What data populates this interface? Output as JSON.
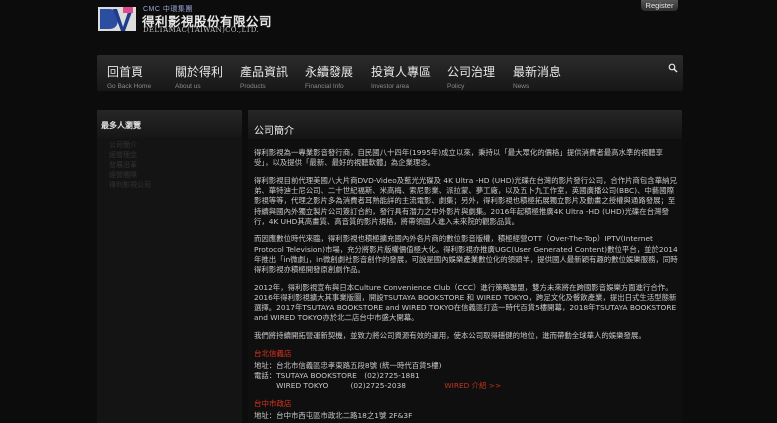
{
  "header": {
    "cmc": "CMC 中環集團",
    "company_cn": "得利影視股份有限公司",
    "company_en": "DELTAMAC(TAIWAN)CO.,LTD.",
    "register_label": "Register"
  },
  "nav": [
    {
      "zh": "回首頁",
      "en": "Go Back Home"
    },
    {
      "zh": "關於得利",
      "en": "About us"
    },
    {
      "zh": "產品資訊",
      "en": "Products"
    },
    {
      "zh": "永續發展",
      "en": "Financial Info"
    },
    {
      "zh": "投資人專區",
      "en": "Investor area"
    },
    {
      "zh": "公司治理",
      "en": "Policy"
    },
    {
      "zh": "最新消息",
      "en": "News"
    }
  ],
  "sidebar": {
    "title": "最多人瀏覽",
    "links": [
      "公司簡介",
      "經營理念",
      "發展沿革",
      "經營團隊",
      "得利影視公司"
    ]
  },
  "main": {
    "title": "公司簡介",
    "paragraphs": [
      "得利影視為一專業影音發行商，自民國八十四年(1995年)成立以來，秉持以「最大眾化的價格」提供消費者最高水準的視聽享受」，以及提供「最新、最好的視聽軟體」為企業理念。",
      "得利影視目前代理美國八大片商DVD-Video及藍光光碟及 4K Ultra -HD (UHD)光碟在台灣的影片發行公司，合作片商包含華納兄弟、華特迪士尼公司、二十世紀福斯、米高梅、索尼影業、派拉蒙、夢工廠，以及五卜九工作室，英國廣播公司(BBC)、中藝國際影視等等，代理之影片多為消費者耳熟能詳的主流電影、劇集；另外，得利影視也積極拓展獨立影片及動畫之授權與通路發展；至持續與國內外獨立製片公司簽訂合約，發行具有潛力之中外影片與劇集。2016年起積極推廣4K Ultra -HD (UHD)光碟在台灣發行，4K UHD其高畫質、高音質的影片規格，將帶領國人進入未來院的觀影品質。",
      "而因應數位時代來臨，得利影視也積極擴充國內外各片商的數位影音版權，積極經營OTT（Over-The-Top）IPTV(Internet Protocol Television)市場，充分將影片版權價值極大化。得利影視亦推廣UGC(User Generated Content)數位平台，並於2014年推出「in微劇」，in微創劇社影音創作的發展，可說是國內娛樂產業數位化的領頭羊，提供國人最新穎有趣的數位娛樂服務，同時得利影視亦積極開發原創劇作品。",
      "2012年，得利影視宣布與日本Culture Convenience Club（CCC）進行策略聯盟，雙方未來將在跨國影音娛樂方面進行合作。2016年得利影視擴大其事業版圖，開設TSUTAYA BOOKSTORE 和 WIRED TOKYO，跨足文化及餐飲產業，提出日式生活型態新選擇。2017年TSUTAYA BOOKSTORE and WIRED TOKYO在信義區打造一時代百貨5樓開幕，2018年TSUTAYA BOOKSTORE and WIRED TOKYO亦於北二店台中市盛大開幕。",
      "我們將持續開拓營運新契機，並致力將公司資源有效的運用，使本公司取得穩健的地位，進而帶動全球華人的娛樂發展。"
    ],
    "branch1": {
      "name": "台北信義店",
      "address": "地址：台北市信義區忠孝東路五段8號 (統一時代百貨5樓)",
      "phone1": "電話：TSUTAYA BOOKSTORE　(02)2725-1881",
      "phone2": "　　　WIRED TOKYO　　　(02)2725-2038",
      "wired_link": "WIRED 介紹 >>"
    },
    "branch2": {
      "name": "台中市政店",
      "address": "地址：台中市西屯區市政北二路18之1號 2F&3F"
    }
  },
  "colors": {
    "accent": "#e0331f",
    "background": "#0c0c0c"
  },
  "icons": {
    "search": "search-icon"
  }
}
